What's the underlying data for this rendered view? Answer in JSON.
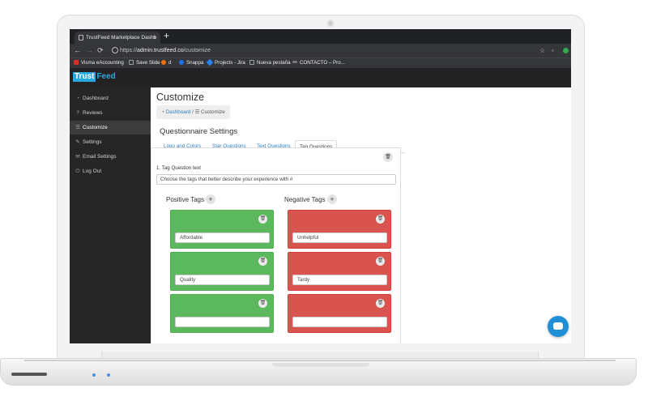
{
  "browser": {
    "tab_title": "TrustFeed Marketplace Dashb",
    "new_tab_icon": "+",
    "url_scheme": "https://",
    "url_host": "admin.trustfeed.co",
    "url_path": "/customize",
    "bookmarks": [
      "Visma eAccounting",
      "Save Slide",
      "d",
      "Snappa",
      "Projects - Jira",
      "Nueva pestaña",
      "CONTACTO – Pro..."
    ],
    "bookmark_colors": [
      "#d93025",
      "#9aa0a6",
      "#e8710a",
      "#1a73e8",
      "#2684ff",
      "#9aa0a6",
      "#777777"
    ]
  },
  "app": {
    "logo_part1": "Trust",
    "logo_part2": "Feed",
    "brand_color": "#29a8e0"
  },
  "sidebar": {
    "items": [
      {
        "label": "Dashboard",
        "icon": "dashboard-icon"
      },
      {
        "label": "Reviews",
        "icon": "question-icon"
      },
      {
        "label": "Customize",
        "icon": "sliders-icon",
        "active": true
      },
      {
        "label": "Settings",
        "icon": "wrench-icon"
      },
      {
        "label": "Email Settings",
        "icon": "envelope-icon"
      },
      {
        "label": "Log Out",
        "icon": "power-icon"
      }
    ]
  },
  "main": {
    "title": "Customize",
    "breadcrumb": {
      "home": "Dashboard",
      "separator": "/",
      "current": "Customize"
    },
    "section_title": "Questionnaire Settings",
    "tabs": [
      "Logo and Colors",
      "Star Questions",
      "Text Questions",
      "Tag Questions"
    ],
    "active_tab": "Tag Questions",
    "question": {
      "label": "1. Tag Question text",
      "value": "Choose the tags that better describe your experience with #"
    },
    "positive_header": "Positive Tags",
    "negative_header": "Negative Tags",
    "positive_tags": [
      "Affordable",
      "Quality",
      ""
    ],
    "negative_tags": [
      "Unhelpful",
      "Tardy",
      ""
    ],
    "positive_color": "#5cb85c",
    "negative_color": "#d9534f"
  }
}
